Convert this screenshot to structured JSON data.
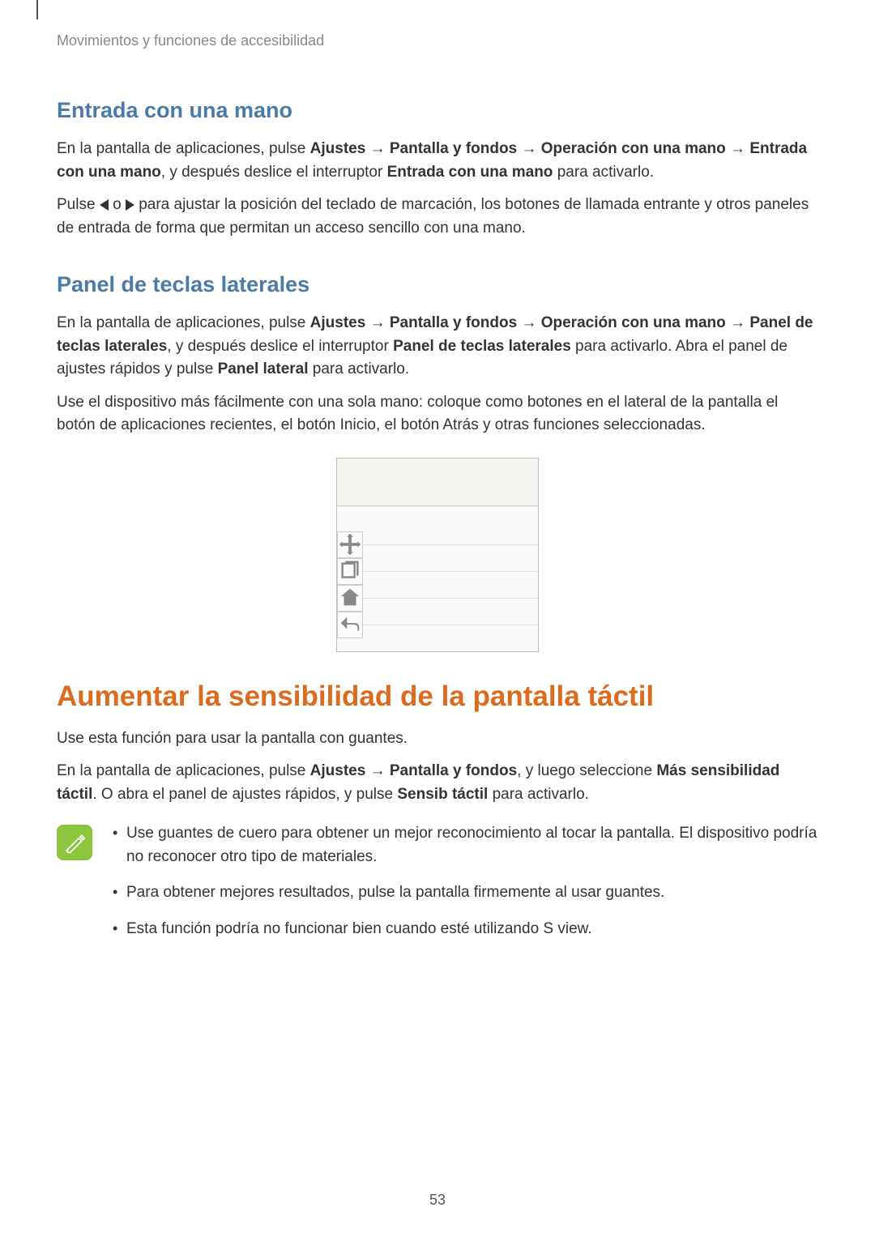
{
  "breadcrumb": "Movimientos y funciones de accesibilidad",
  "sections": {
    "s1": {
      "heading": "Entrada con una mano",
      "p1_a": "En la pantalla de aplicaciones, pulse ",
      "p1_b": "Ajustes",
      "p1_c": " → ",
      "p1_d": "Pantalla y fondos",
      "p1_e": " → ",
      "p1_f": "Operación con una mano",
      "p1_g": " → ",
      "p1_h": "Entrada con una mano",
      "p1_i": ", y después deslice el interruptor ",
      "p1_j": "Entrada con una mano",
      "p1_k": " para activarlo.",
      "p2_a": "Pulse ",
      "p2_b": " o ",
      "p2_c": " para ajustar la posición del teclado de marcación, los botones de llamada entrante y otros paneles de entrada de forma que permitan un acceso sencillo con una mano."
    },
    "s2": {
      "heading": "Panel de teclas laterales",
      "p1_a": "En la pantalla de aplicaciones, pulse ",
      "p1_b": "Ajustes",
      "p1_c": " → ",
      "p1_d": "Pantalla y fondos",
      "p1_e": " → ",
      "p1_f": "Operación con una mano",
      "p1_g": " → ",
      "p1_h": "Panel de teclas laterales",
      "p1_i": ", y después deslice el interruptor ",
      "p1_j": "Panel de teclas laterales",
      "p1_k": " para activarlo. Abra el panel de ajustes rápidos y pulse ",
      "p1_l": "Panel lateral",
      "p1_m": " para activarlo.",
      "p2": "Use el dispositivo más fácilmente con una sola mano: coloque como botones en el lateral de la pantalla el botón de aplicaciones recientes, el botón Inicio, el botón Atrás y otras funciones seleccionadas."
    },
    "s3": {
      "heading": "Aumentar la sensibilidad de la pantalla táctil",
      "p1": "Use esta función para usar la pantalla con guantes.",
      "p2_a": "En la pantalla de aplicaciones, pulse ",
      "p2_b": "Ajustes",
      "p2_c": " → ",
      "p2_d": "Pantalla y fondos",
      "p2_e": ", y luego seleccione ",
      "p2_f": "Más sensibilidad táctil",
      "p2_g": ". O abra el panel de ajustes rápidos, y pulse ",
      "p2_h": "Sensib táctil",
      "p2_i": " para activarlo.",
      "notes": [
        "Use guantes de cuero para obtener un mejor reconocimiento al tocar la pantalla. El dispositivo podría no reconocer otro tipo de materiales.",
        "Para obtener mejores resultados, pulse la pantalla firmemente al usar guantes.",
        "Esta función podría no funcionar bien cuando esté utilizando S view."
      ]
    }
  },
  "page_number": "53"
}
